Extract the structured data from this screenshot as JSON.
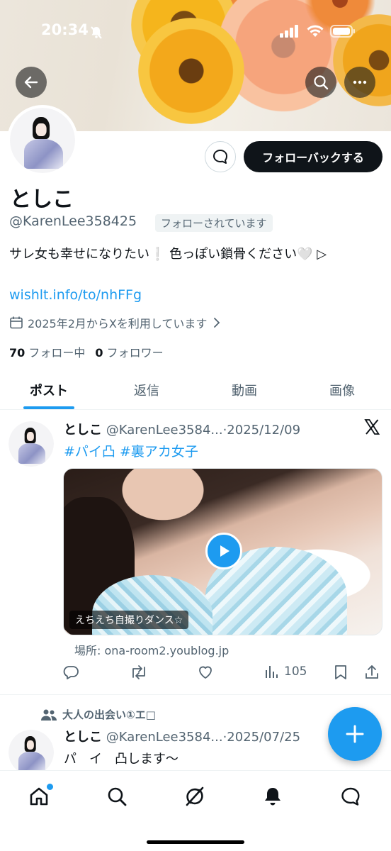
{
  "status_bar": {
    "time": "20:34"
  },
  "profile": {
    "name": "としこ",
    "handle": "@KarenLee358425",
    "follows_you": "フォローされています",
    "follow_button": "フォローバックする",
    "bio": "サレ女も幸せになりたい❕ 色っぽい鎖骨ください🤍 ▷",
    "link": "wishlt.info/to/nhFFg",
    "joined": "2025年2月からXを利用しています",
    "following_count": "70",
    "following_label": "フォロー中",
    "followers_count": "0",
    "followers_label": "フォロワー"
  },
  "tabs": [
    {
      "label": "ポスト",
      "active": true
    },
    {
      "label": "返信",
      "active": false
    },
    {
      "label": "動画",
      "active": false
    },
    {
      "label": "画像",
      "active": false
    }
  ],
  "posts": [
    {
      "name": "としこ",
      "meta": "@KarenLee3584...·2025/12/09",
      "hashtags": "#パイ凸 #裏アカ女子",
      "media_caption": "えちえち自撮りダンス☆",
      "location": "場所: ona-room2.youblog.jp",
      "views": "105"
    },
    {
      "repost_label": "大人の出会い①エ□",
      "name": "としこ",
      "meta": "@KarenLee3584...·2025/07/25",
      "text": "パ　イ　凸します〜"
    }
  ],
  "colors": {
    "accent": "#1d9bf0",
    "text": "#0f1419",
    "secondary": "#536471"
  }
}
